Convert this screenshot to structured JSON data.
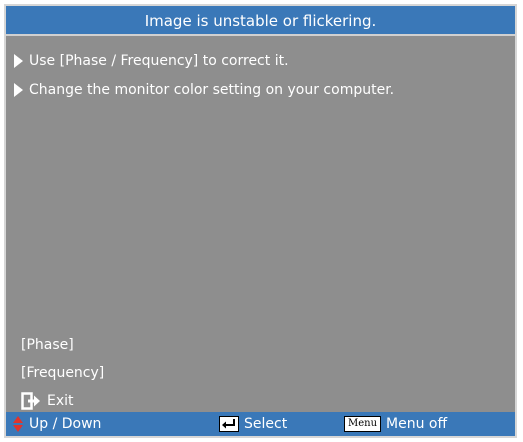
{
  "title": "Image is unstable or flickering.",
  "tips": [
    "Use [Phase / Frequency] to correct it.",
    "Change the monitor color setting on your computer."
  ],
  "menu": {
    "phase": "[Phase]",
    "frequency": "[Frequency]",
    "exit": "Exit"
  },
  "footer": {
    "nav": "Up / Down",
    "select": "Select",
    "menu_key": "Menu",
    "menu_off": "Menu off"
  },
  "colors": {
    "panel": "#8e8e8e",
    "bar": "#3a78b8",
    "text": "#ffffff",
    "nav_arrow": "#e0342b"
  },
  "icons": {
    "tip": "triangle-right-icon",
    "exit": "exit-door-icon",
    "nav": "up-down-arrow-icon",
    "select": "enter-key-icon"
  }
}
